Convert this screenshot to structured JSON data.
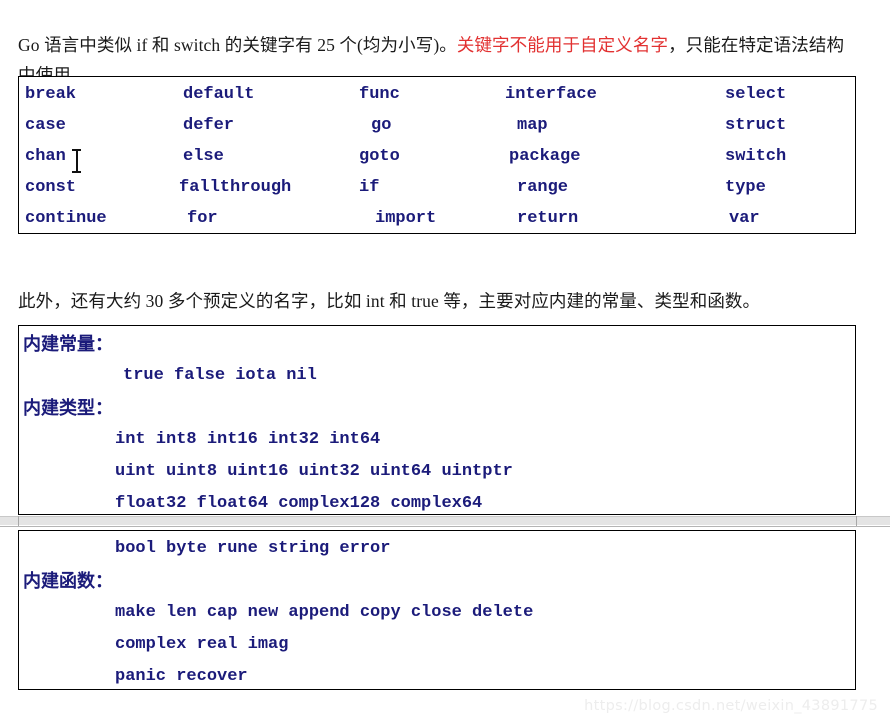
{
  "document": {
    "paragraphs": {
      "intro_before_red": "Go 语言中类似 if 和 switch 的关键字有 25 个(均为小写)。",
      "intro_red": "关键字不能用于自定义名字",
      "intro_after_red": "，只能在特定语法结构中使用。",
      "predeclared": "此外，还有大约 30 多个预定义的名字，比如 int 和 true 等，主要对应内建的常量、类型和函数。"
    },
    "keyword_box": {
      "rows": [
        [
          "break",
          "default",
          "func",
          "interface",
          "select"
        ],
        [
          "case",
          "defer",
          "go",
          "map",
          "struct"
        ],
        [
          "chan",
          "else",
          "goto",
          "package",
          "switch"
        ],
        [
          "const",
          "fallthrough",
          "if",
          "range",
          "type"
        ],
        [
          "continue",
          "for",
          "import",
          "return",
          "var"
        ]
      ]
    },
    "builtin_box_a": {
      "constants_label": "内建常量：",
      "constants_values": "true false iota nil",
      "types_label": "内建类型：",
      "types_values": [
        "int int8 int16 int32 int64",
        "uint uint8 uint16 uint32 uint64 uintptr",
        "float32 float64 complex128 complex64"
      ]
    },
    "builtin_box_b": {
      "types_values_cont": "bool byte rune string error",
      "functions_label": "内建函数：",
      "functions_values": [
        "make len cap new append copy close delete",
        "complex real imag",
        "panic recover"
      ]
    },
    "watermark": "https://blog.csdn.net/weixin_43891775",
    "colors": {
      "code_blue": "#1b1b7a",
      "highlight_red": "#e23131",
      "body_text": "#1a1a1a",
      "box_border": "#000000",
      "page_background": "#ffffff"
    }
  }
}
